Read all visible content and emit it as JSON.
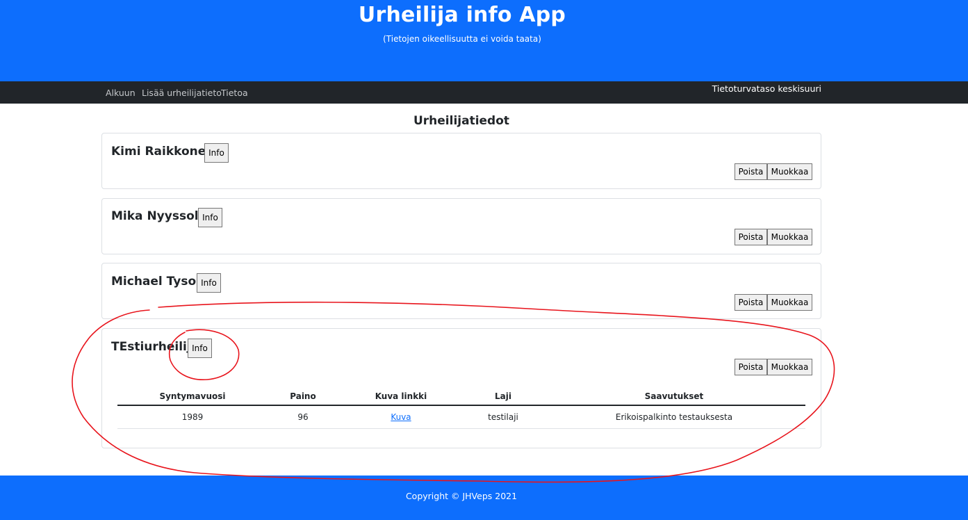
{
  "header": {
    "title": "Urheilija info App",
    "subtitle": "(Tietojen oikeellisuutta ei voida taata)"
  },
  "nav": {
    "items": [
      {
        "label": "Alkuun"
      },
      {
        "label": "Lisää urheilijatieto"
      },
      {
        "label": "Tietoa"
      }
    ],
    "security_level": "Tietoturvataso keskisuuri"
  },
  "main": {
    "title": "Urheilijatiedot",
    "athletes": [
      {
        "name": "Kimi Raikkonen",
        "info_label": "Info",
        "delete_label": "Poista",
        "edit_label": "Muokkaa"
      },
      {
        "name": "Mika Nyyssola",
        "info_label": "Info",
        "delete_label": "Poista",
        "edit_label": "Muokkaa"
      },
      {
        "name": "Michael Tyson",
        "info_label": "Info",
        "delete_label": "Poista",
        "edit_label": "Muokkaa"
      },
      {
        "name": "TEstiurheilija",
        "info_label": "Info",
        "delete_label": "Poista",
        "edit_label": "Muokkaa",
        "details": {
          "columns": [
            "Syntymavuosi",
            "Paino",
            "Kuva linkki",
            "Laji",
            "Saavutukset"
          ],
          "row": {
            "birth_year": "1989",
            "weight": "96",
            "image_link": "Kuva",
            "sport": "testilaji",
            "achievements": "Erikoispalkinto testauksesta"
          }
        }
      }
    ]
  },
  "footer": {
    "text": "Copyright © JHVeps 2021"
  },
  "colors": {
    "primary": "#0d6efd",
    "navbar": "#212529",
    "annotation": "#e8141c"
  }
}
